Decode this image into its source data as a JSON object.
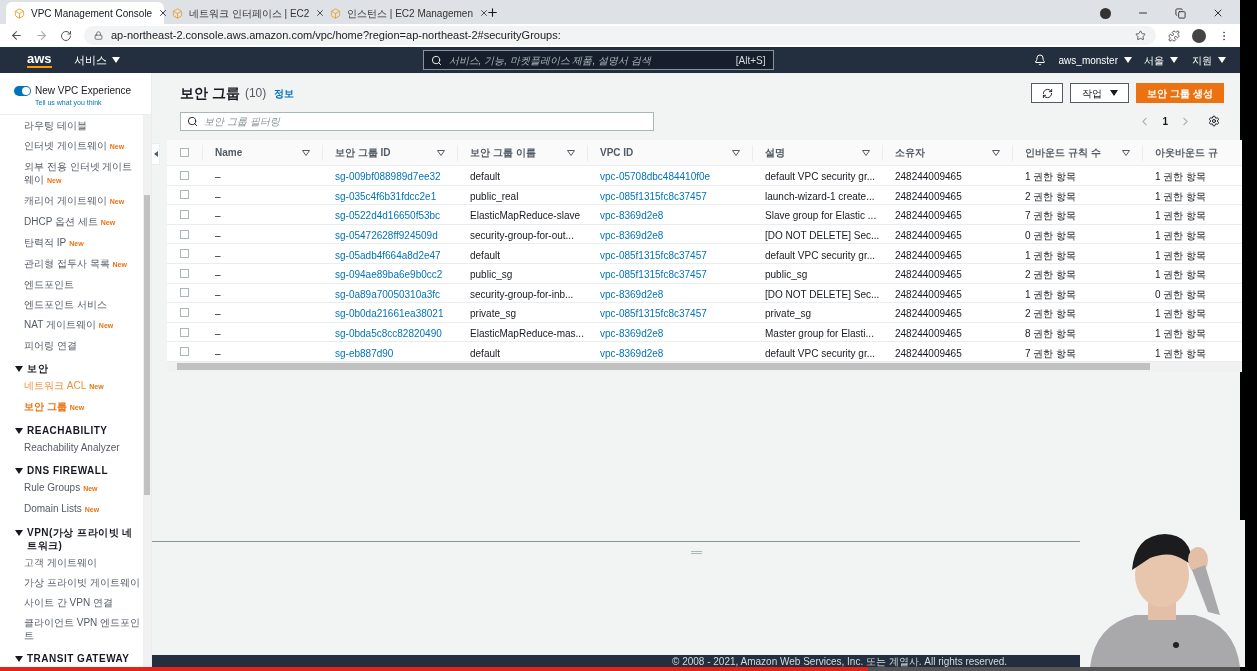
{
  "browser": {
    "tabs": [
      {
        "title": "VPC Management Console",
        "selected": true
      },
      {
        "title": "네트워크 인터페이스 | EC2",
        "selected": false
      },
      {
        "title": "인스턴스 | EC2 Managemen",
        "selected": false
      }
    ],
    "url": "ap-northeast-2.console.aws.amazon.com/vpc/home?region=ap-northeast-2#securityGroups:"
  },
  "nav": {
    "logo": "aws",
    "services": "서비스",
    "search_placeholder": "서비스, 기능, 마켓플레이스 제품, 설명서 검색",
    "shortcut": "[Alt+S]",
    "user": "aws_monster",
    "region": "서울",
    "support": "지원"
  },
  "sidebar": {
    "toggle": {
      "label": "New VPC Experience",
      "on": true
    },
    "feedback": "Tell us what you think",
    "sections": [
      {
        "items": [
          {
            "label": "라우팅 테이블",
            "selected": false,
            "hovered": false
          },
          {
            "label": "인터넷 게이트웨이",
            "badge": "New",
            "selected": false,
            "hovered": false
          },
          {
            "label": "외부 전용 인터넷 게이트웨이",
            "badge": "New",
            "selected": false,
            "hovered": false
          },
          {
            "label": "캐리어 게이트웨이",
            "badge": "New",
            "selected": false,
            "hovered": false
          },
          {
            "label": "DHCP 옵션 세트",
            "badge": "New",
            "selected": false,
            "hovered": false
          },
          {
            "label": "탄력적 IP",
            "badge": "New",
            "selected": false,
            "hovered": false
          },
          {
            "label": "관리형 접두사 목록",
            "badge": "New",
            "selected": false,
            "hovered": false
          },
          {
            "label": "엔드포인트",
            "selected": false,
            "hovered": false
          },
          {
            "label": "엔드포인트 서비스",
            "selected": false,
            "hovered": false
          },
          {
            "label": "NAT 게이트웨이",
            "badge": "New",
            "selected": false,
            "hovered": false
          },
          {
            "label": "피어링 연결",
            "selected": false,
            "hovered": false
          }
        ]
      },
      {
        "heading": "보안",
        "expanded": true,
        "items": [
          {
            "label": "네트워크 ACL",
            "badge": "New",
            "selected": false,
            "hovered": true
          },
          {
            "label": "보안 그룹",
            "badge": "New",
            "selected": true,
            "hovered": false
          }
        ]
      },
      {
        "heading": "REACHABILITY",
        "expanded": true,
        "items": [
          {
            "label": "Reachability Analyzer",
            "selected": false,
            "hovered": false
          }
        ]
      },
      {
        "heading": "DNS FIREWALL",
        "expanded": true,
        "items": [
          {
            "label": "Rule Groups",
            "badge": "New",
            "selected": false,
            "hovered": false
          },
          {
            "label": "Domain Lists",
            "badge": "New",
            "selected": false,
            "hovered": false
          }
        ]
      },
      {
        "heading": "VPN(가상 프라이빗 네트워크)",
        "expanded": true,
        "items": [
          {
            "label": "고객 게이트웨이",
            "selected": false,
            "hovered": false
          },
          {
            "label": "가상 프라이빗 게이트웨이",
            "selected": false,
            "hovered": false
          },
          {
            "label": "사이트 간 VPN 연결",
            "selected": false,
            "hovered": false
          },
          {
            "label": "클라이언트 VPN 엔드포인트",
            "selected": false,
            "hovered": false
          }
        ]
      },
      {
        "heading": "TRANSIT GATEWAY",
        "expanded": true
      }
    ]
  },
  "footer": "© 2008 - 2021, Amazon Web Services, Inc. 또는 계열사. All rights reserved.",
  "panel": {
    "title": "보안 그룹",
    "count": "(10)",
    "info": "정보",
    "actions": "작업",
    "create": "보안 그룹 생성",
    "filter_placeholder": "보안 그룹 필터링",
    "page": "1"
  },
  "table": {
    "select_all_checked": false,
    "columns": [
      "Name",
      "보안 그룹 ID",
      "보안 그룹 이름",
      "VPC ID",
      "설명",
      "소유자",
      "인바운드 규칙 수",
      "아웃바운드 규"
    ],
    "rows": [
      {
        "checked": false,
        "cells": [
          "–",
          "sg-009bf088989d7ee32",
          "default",
          "vpc-05708dbc484410f0e",
          "default VPC security gr...",
          "248244009465",
          "1 권한 항목",
          "1 권한 항목"
        ]
      },
      {
        "checked": false,
        "cells": [
          "–",
          "sg-035c4f6b31fdcc2e1",
          "public_real",
          "vpc-085f1315fc8c37457",
          "launch-wizard-1 create...",
          "248244009465",
          "2 권한 항목",
          "1 권한 항목"
        ]
      },
      {
        "checked": false,
        "cells": [
          "–",
          "sg-0522d4d16650f53bc",
          "ElasticMapReduce-slave",
          "vpc-8369d2e8",
          "Slave group for Elastic ...",
          "248244009465",
          "7 권한 항목",
          "1 권한 항목"
        ]
      },
      {
        "checked": false,
        "cells": [
          "–",
          "sg-05472628ff924509d",
          "security-group-for-out...",
          "vpc-8369d2e8",
          "[DO NOT DELETE] Sec...",
          "248244009465",
          "0 권한 항목",
          "1 권한 항목"
        ]
      },
      {
        "checked": false,
        "cells": [
          "–",
          "sg-05adb4f664a8d2e47",
          "default",
          "vpc-085f1315fc8c37457",
          "default VPC security gr...",
          "248244009465",
          "1 권한 항목",
          "1 권한 항목"
        ]
      },
      {
        "checked": false,
        "cells": [
          "–",
          "sg-094ae89ba6e9b0cc2",
          "public_sg",
          "vpc-085f1315fc8c37457",
          "public_sg",
          "248244009465",
          "2 권한 항목",
          "1 권한 항목"
        ]
      },
      {
        "checked": false,
        "cells": [
          "–",
          "sg-0a89a70050310a3fc",
          "security-group-for-inb...",
          "vpc-8369d2e8",
          "[DO NOT DELETE] Sec...",
          "248244009465",
          "1 권한 항목",
          "0 권한 항목"
        ]
      },
      {
        "checked": false,
        "cells": [
          "–",
          "sg-0b0da21661ea38021",
          "private_sg",
          "vpc-085f1315fc8c37457",
          "private_sg",
          "248244009465",
          "2 권한 항목",
          "1 권한 항목"
        ]
      },
      {
        "checked": false,
        "cells": [
          "–",
          "sg-0bda5c8cc82820490",
          "ElasticMapReduce-mas...",
          "vpc-8369d2e8",
          "Master group for Elasti...",
          "248244009465",
          "8 권한 항목",
          "1 권한 항목"
        ]
      },
      {
        "checked": false,
        "cells": [
          "–",
          "sg-eb887d90",
          "default",
          "vpc-8369d2e8",
          "default VPC security gr...",
          "248244009465",
          "7 권한 항목",
          "1 권한 항목"
        ]
      }
    ]
  },
  "video": {
    "kind": "picture",
    "level": 0.7
  }
}
